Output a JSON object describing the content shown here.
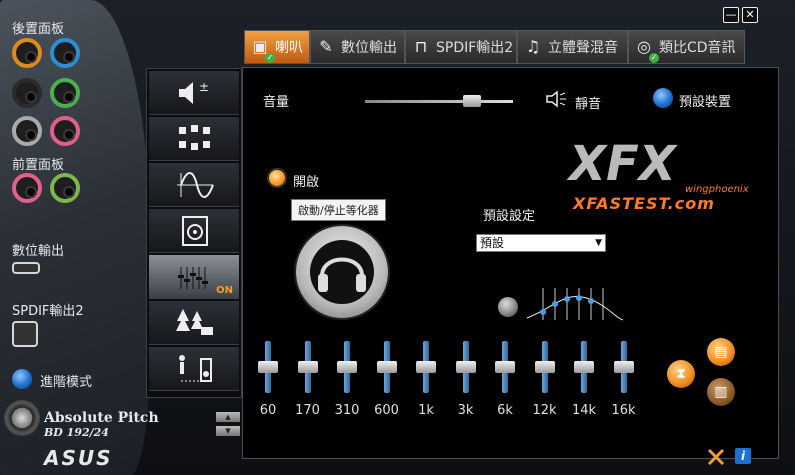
{
  "window": {
    "minimize_label": "—",
    "close_label": "✕"
  },
  "sidebar": {
    "rear_panel_label": "後置面板",
    "front_panel_label": "前置面板",
    "digital_out_label": "數位輸出",
    "spdif_out_label": "SPDIF輸出2",
    "advanced_mode_label": "進階模式",
    "rear_jacks": [
      {
        "color": "#e08a1c"
      },
      {
        "color": "#2c8fd6"
      },
      {
        "color": "#2a2a2a"
      },
      {
        "color": "#4caf50"
      },
      {
        "color": "#aaaaaa"
      },
      {
        "color": "#e0608a"
      }
    ],
    "front_jacks": [
      {
        "color": "#e0608a"
      },
      {
        "color": "#7ab84a"
      }
    ]
  },
  "tabs": [
    {
      "label": "喇叭",
      "icon": "speaker-icon",
      "active": true,
      "check": true
    },
    {
      "label": "數位輸出",
      "icon": "plug-icon",
      "active": false,
      "check": false
    },
    {
      "label": "SPDIF輸出2",
      "icon": "pulse-icon",
      "active": false,
      "check": false
    },
    {
      "label": "立體聲混音",
      "icon": "music-note-icon",
      "active": false,
      "check": false
    },
    {
      "label": "類比CD音訊",
      "icon": "cd-icon",
      "active": false,
      "check": true
    }
  ],
  "functions": [
    {
      "name": "volume-function",
      "icon": "speaker-plus-minus-icon"
    },
    {
      "name": "surround-function",
      "icon": "speaker-array-icon"
    },
    {
      "name": "waveform-function",
      "icon": "sine-wave-icon"
    },
    {
      "name": "subwoofer-function",
      "icon": "woofer-icon"
    },
    {
      "name": "equalizer-function",
      "icon": "equalizer-icon",
      "on_label": "ON"
    },
    {
      "name": "environment-function",
      "icon": "forest-icon"
    },
    {
      "name": "distance-function",
      "icon": "listener-speaker-icon"
    }
  ],
  "main": {
    "volume_label": "音量",
    "volume_level": 0.72,
    "mute_label": "靜音",
    "default_device_label": "預設裝置",
    "enable_label": "開啟",
    "tooltip_text": "啟動/停止等化器",
    "preset_label": "預設設定",
    "preset_value": "預設",
    "watermark_text": "XFASTEST.com",
    "watermark_sub": "wingphoenix"
  },
  "equalizer": {
    "bands": [
      "60",
      "170",
      "310",
      "600",
      "1k",
      "3k",
      "6k",
      "12k",
      "14k",
      "16k"
    ],
    "levels": [
      0.5,
      0.5,
      0.5,
      0.5,
      0.5,
      0.5,
      0.5,
      0.5,
      0.5,
      0.5
    ]
  },
  "branding": {
    "product_line1": "Absolute Pitch",
    "product_line2": "BD 192/24",
    "brand": "ASUS"
  },
  "accent_color": "#f08a1a"
}
